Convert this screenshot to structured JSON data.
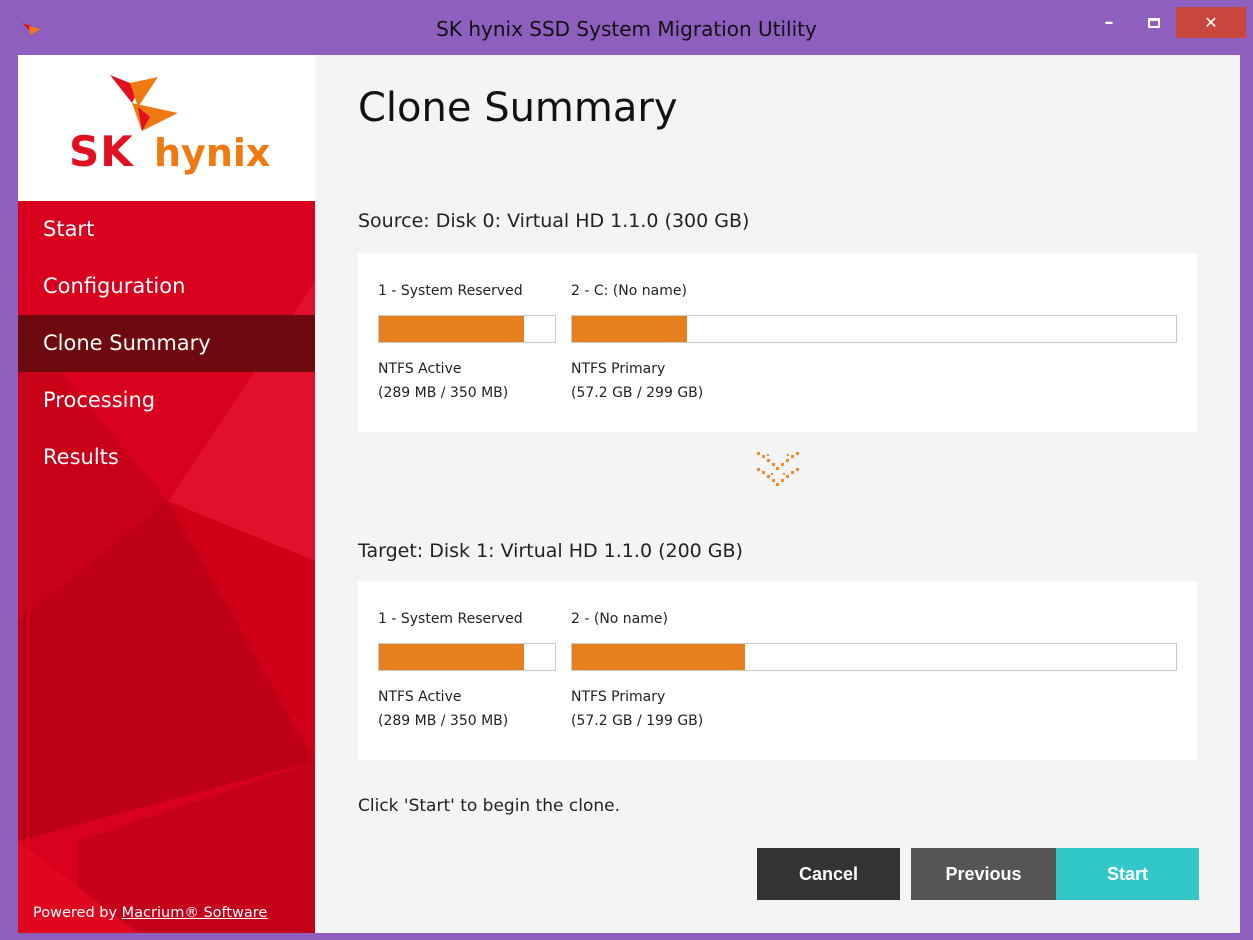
{
  "window": {
    "title": "SK hynix SSD System Migration Utility",
    "minimize_glyph": "–",
    "close_glyph": "✕"
  },
  "logo": {
    "brand_sk": "SK",
    "brand_hynix": "hynix"
  },
  "sidebar": {
    "items": [
      {
        "label": "Start",
        "active": false
      },
      {
        "label": "Configuration",
        "active": false
      },
      {
        "label": "Clone Summary",
        "active": true
      },
      {
        "label": "Processing",
        "active": false
      },
      {
        "label": "Results",
        "active": false
      }
    ],
    "powered_prefix": "Powered by",
    "powered_link": "Macrium® Software"
  },
  "page": {
    "title": "Clone Summary"
  },
  "source": {
    "heading": "Source: Disk 0: Virtual HD 1.1.0 (300 GB)",
    "partitions": [
      {
        "name": "1 - System Reserved",
        "fs": "NTFS Active",
        "size": "(289 MB / 350 MB)",
        "used_fraction": 0.826
      },
      {
        "name": "2 - C: (No name)",
        "fs": "NTFS Primary",
        "size": "(57.2 GB / 299 GB)",
        "used_fraction": 0.191
      }
    ]
  },
  "target": {
    "heading": "Target: Disk 1: Virtual HD 1.1.0 (200 GB)",
    "partitions": [
      {
        "name": "1 - System Reserved",
        "fs": "NTFS Active",
        "size": "(289 MB / 350 MB)",
        "used_fraction": 0.826
      },
      {
        "name": "2 - (No name)",
        "fs": "NTFS Primary",
        "size": "(57.2 GB / 199 GB)",
        "used_fraction": 0.287
      }
    ]
  },
  "hint": "Click 'Start' to begin the clone.",
  "buttons": {
    "cancel": "Cancel",
    "previous": "Previous",
    "start": "Start"
  },
  "colors": {
    "accent_red": "#d8001c",
    "active_nav": "#6e0a0f",
    "partition_fill": "#e6801e",
    "start_button": "#33c8c8",
    "titlebar": "#8f5fbf"
  }
}
